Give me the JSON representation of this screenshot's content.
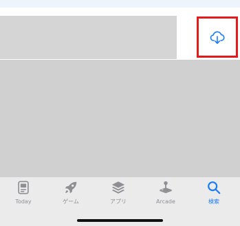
{
  "colors": {
    "accent": "#1a7bf2",
    "inactive": "#8e8e93",
    "highlight": "#e11b1b",
    "placeholder": "#d3d3d3"
  },
  "content": {
    "download_icon": "cloud-download-icon"
  },
  "tabbar": {
    "items": [
      {
        "label": "Today",
        "icon": "today-icon",
        "active": false
      },
      {
        "label": "ゲーム",
        "icon": "rocket-icon",
        "active": false
      },
      {
        "label": "アプリ",
        "icon": "layers-icon",
        "active": false
      },
      {
        "label": "Arcade",
        "icon": "joystick-icon",
        "active": false
      },
      {
        "label": "検索",
        "icon": "search-icon",
        "active": true
      }
    ]
  }
}
